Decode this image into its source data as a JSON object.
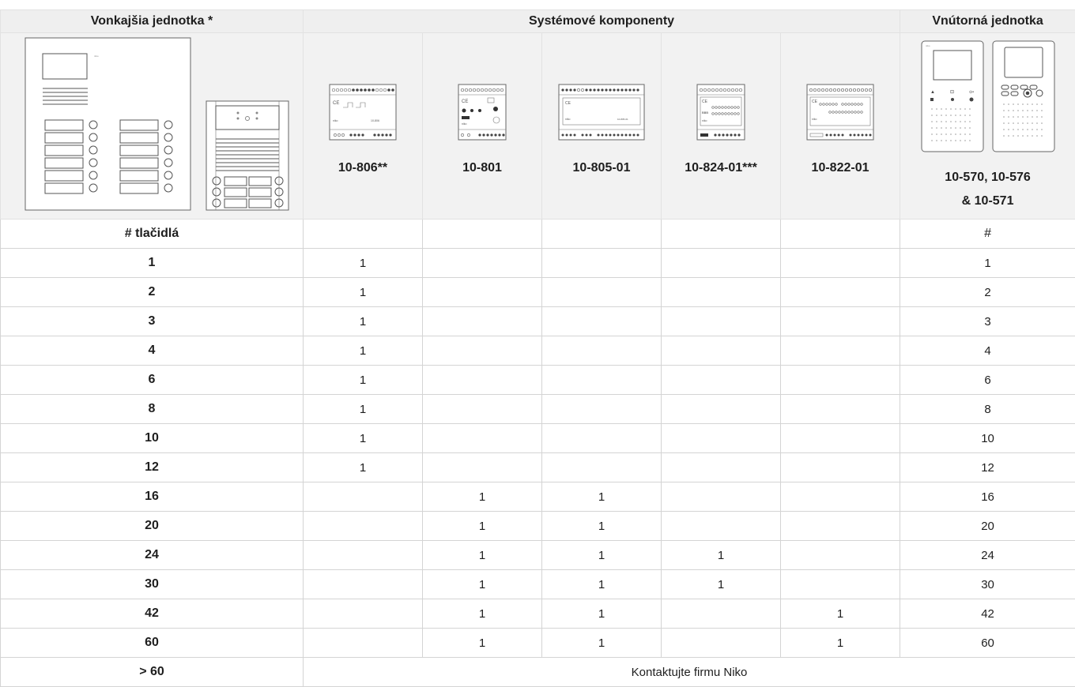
{
  "header": {
    "outdoor": "Vonkajšia jednotka *",
    "system": "Systémové komponenty",
    "indoor": "Vnútorná jednotka"
  },
  "components": [
    "10-806**",
    "10-801",
    "10-805-01",
    "10-824-01***",
    "10-822-01"
  ],
  "indoor_code_line1": "10-570, 10-576",
  "indoor_code_line2": "& 10-571",
  "label_row": {
    "buttons": "# tlačidlá",
    "indoor": "#"
  },
  "rows": [
    {
      "buttons": "1",
      "c806": "1",
      "c801": "",
      "c805": "",
      "c824": "",
      "c822": "",
      "indoor": "1"
    },
    {
      "buttons": "2",
      "c806": "1",
      "c801": "",
      "c805": "",
      "c824": "",
      "c822": "",
      "indoor": "2"
    },
    {
      "buttons": "3",
      "c806": "1",
      "c801": "",
      "c805": "",
      "c824": "",
      "c822": "",
      "indoor": "3"
    },
    {
      "buttons": "4",
      "c806": "1",
      "c801": "",
      "c805": "",
      "c824": "",
      "c822": "",
      "indoor": "4"
    },
    {
      "buttons": "6",
      "c806": "1",
      "c801": "",
      "c805": "",
      "c824": "",
      "c822": "",
      "indoor": "6"
    },
    {
      "buttons": "8",
      "c806": "1",
      "c801": "",
      "c805": "",
      "c824": "",
      "c822": "",
      "indoor": "8"
    },
    {
      "buttons": "10",
      "c806": "1",
      "c801": "",
      "c805": "",
      "c824": "",
      "c822": "",
      "indoor": "10"
    },
    {
      "buttons": "12",
      "c806": "1",
      "c801": "",
      "c805": "",
      "c824": "",
      "c822": "",
      "indoor": "12"
    },
    {
      "buttons": "16",
      "c806": "",
      "c801": "1",
      "c805": "1",
      "c824": "",
      "c822": "",
      "indoor": "16"
    },
    {
      "buttons": "20",
      "c806": "",
      "c801": "1",
      "c805": "1",
      "c824": "",
      "c822": "",
      "indoor": "20"
    },
    {
      "buttons": "24",
      "c806": "",
      "c801": "1",
      "c805": "1",
      "c824": "1",
      "c822": "",
      "indoor": "24"
    },
    {
      "buttons": "30",
      "c806": "",
      "c801": "1",
      "c805": "1",
      "c824": "1",
      "c822": "",
      "indoor": "30"
    },
    {
      "buttons": "42",
      "c806": "",
      "c801": "1",
      "c805": "1",
      "c824": "",
      "c822": "1",
      "indoor": "42"
    },
    {
      "buttons": "60",
      "c806": "",
      "c801": "1",
      "c805": "1",
      "c824": "",
      "c822": "1",
      "indoor": "60"
    }
  ],
  "last_row": {
    "buttons": "> 60",
    "note": "Kontaktujte firmu Niko"
  }
}
